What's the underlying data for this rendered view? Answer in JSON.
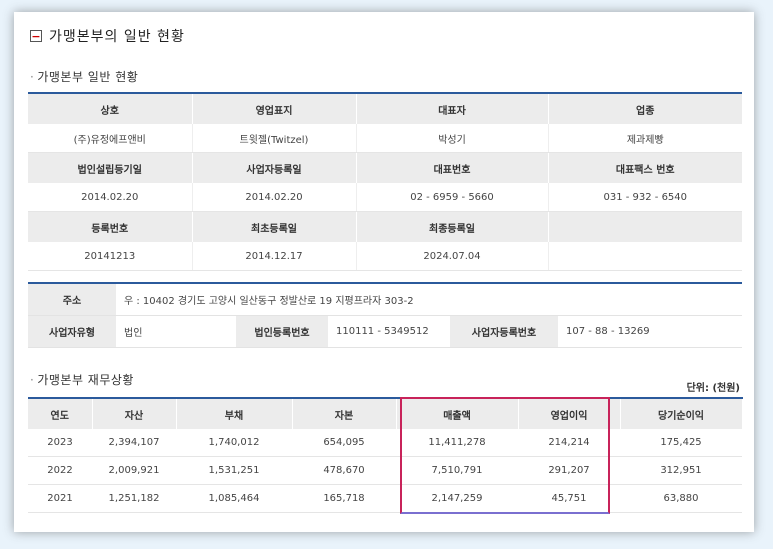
{
  "title": "가맹본부의 일반 현황",
  "toggle_symbol": "−",
  "section1_title": "가맹본부 일반 현황",
  "general": {
    "headers1": [
      "상호",
      "영업표지",
      "대표자",
      "업종"
    ],
    "values1": [
      "(주)유정에프앤비",
      "트윗젤(Twitzel)",
      "박성기",
      "제과제빵"
    ],
    "headers2": [
      "법인설립등기일",
      "사업자등록일",
      "대표번호",
      "대표팩스 번호"
    ],
    "values2": [
      "2014.02.20",
      "2014.02.20",
      "02 - 6959 - 5660",
      "031 - 932 - 6540"
    ],
    "headers3": [
      "등록번호",
      "최초등록일",
      "최종등록일",
      ""
    ],
    "values3": [
      "20141213",
      "2014.12.17",
      "2024.07.04",
      ""
    ]
  },
  "address": {
    "label": "주소",
    "value": "우 : 10402 경기도 고양시 일산동구 정발산로 19 지평프라자 303-2",
    "biz_type_label": "사업자유형",
    "biz_type_value": "법인",
    "corp_no_label": "법인등록번호",
    "corp_no_value": "110111 - 5349512",
    "biz_no_label": "사업자등록번호",
    "biz_no_value": "107 - 88 - 13269"
  },
  "section2_title": "가맹본부 재무상황",
  "unit_label": "단위: (천원)",
  "finance": {
    "headers": [
      "연도",
      "자산",
      "부채",
      "자본",
      "매출액",
      "영업이익",
      "당기순이익"
    ],
    "rows": [
      [
        "2023",
        "2,394,107",
        "1,740,012",
        "654,095",
        "11,411,278",
        "214,214",
        "175,425"
      ],
      [
        "2022",
        "2,009,921",
        "1,531,251",
        "478,670",
        "7,510,791",
        "291,207",
        "312,951"
      ],
      [
        "2021",
        "1,251,182",
        "1,085,464",
        "165,718",
        "2,147,259",
        "45,751",
        "63,880"
      ]
    ]
  },
  "colors": {
    "accent_line": "#2b5a9c",
    "highlight": "#c8235a",
    "header_bg": "#ececec"
  }
}
